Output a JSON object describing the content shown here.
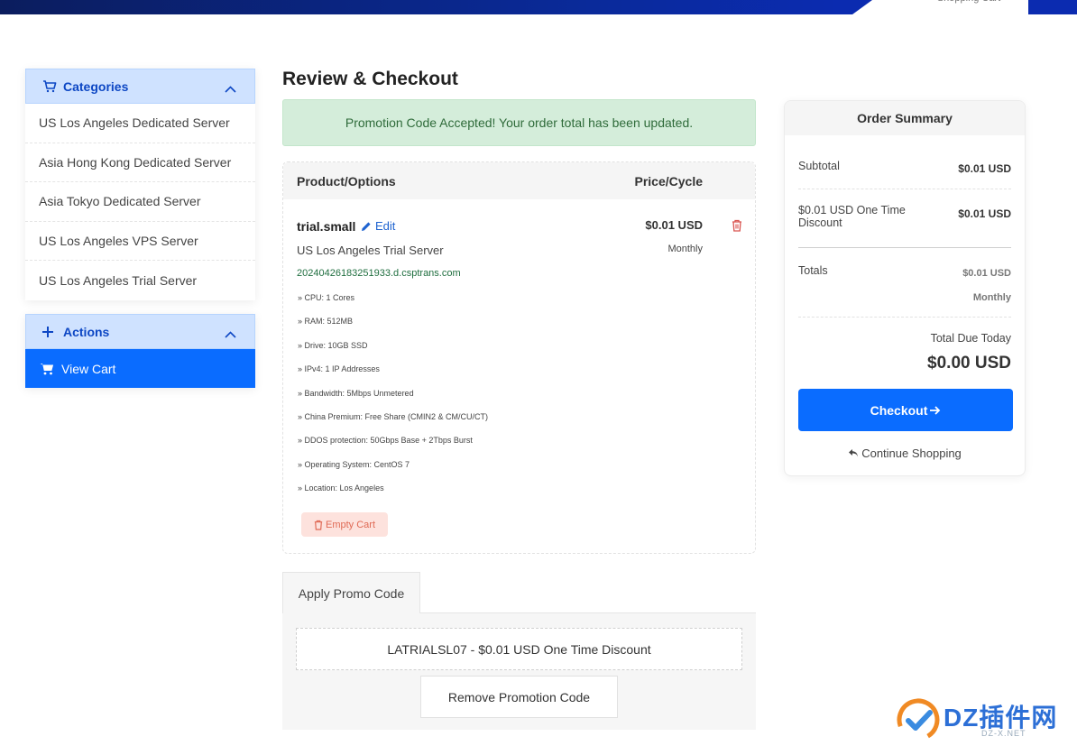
{
  "header": {
    "tab_label": "Shopping Cart"
  },
  "sidebar": {
    "categories_title": "Categories",
    "categories": [
      "US Los Angeles Dedicated Server",
      "Asia Hong Kong Dedicated Server",
      "Asia Tokyo Dedicated Server",
      "US Los Angeles VPS Server",
      "US Los Angeles Trial Server"
    ],
    "actions_title": "Actions",
    "view_cart_label": "View Cart"
  },
  "main": {
    "title": "Review & Checkout",
    "alert": "Promotion Code Accepted! Your order total has been updated.",
    "cart": {
      "col_product": "Product/Options",
      "col_price": "Price/Cycle",
      "product_name": "trial.small",
      "edit_label": "Edit",
      "price": "$0.01 USD",
      "cycle": "Monthly",
      "group": "US Los Angeles Trial Server",
      "domain": "20240426183251933.d.csptrans.com",
      "options": [
        "» CPU: 1 Cores",
        "» RAM: 512MB",
        "» Drive: 10GB SSD",
        "» IPv4: 1 IP Addresses",
        "» Bandwidth: 5Mbps Unmetered",
        "» China Premium: Free Share (CMIN2 & CM/CU/CT)",
        "» DDOS protection: 50Gbps Base + 2Tbps Burst",
        "» Operating System: CentOS 7",
        "» Location: Los Angeles"
      ],
      "empty_cart_label": "Empty Cart"
    },
    "promo": {
      "tab_label": "Apply Promo Code",
      "applied_code": "LATRIALSL07 - $0.01 USD One Time Discount",
      "remove_label": "Remove Promotion Code"
    }
  },
  "summary": {
    "title": "Order Summary",
    "subtotal_label": "Subtotal",
    "subtotal_value": "$0.01 USD",
    "discount_label": "$0.01 USD One Time Discount",
    "discount_value": "$0.01 USD",
    "totals_label": "Totals",
    "totals_value": "$0.01 USD",
    "totals_cycle": "Monthly",
    "due_label": "Total Due Today",
    "due_amount": "$0.00 USD",
    "checkout_label": "Checkout",
    "continue_label": "Continue Shopping"
  },
  "watermark": {
    "brand": "DZ插件网",
    "sub": "DZ-X.NET"
  },
  "colors": {
    "primary": "#0a6cff",
    "alert_bg": "#d4edda",
    "category_head_bg": "#cfe2ff",
    "danger": "#e06a55"
  }
}
